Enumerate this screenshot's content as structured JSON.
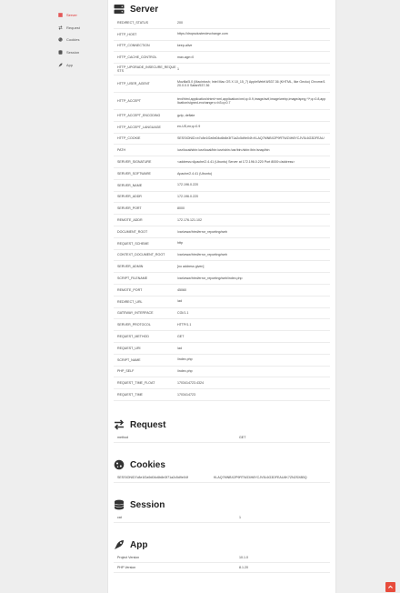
{
  "nav": {
    "items": [
      {
        "label": "Server",
        "icon": "server-icon",
        "active": true
      },
      {
        "label": "Request",
        "icon": "exchange-icon",
        "active": false
      },
      {
        "label": "Cookies",
        "icon": "cookie-icon",
        "active": false
      },
      {
        "label": "Session",
        "icon": "database-icon",
        "active": false
      },
      {
        "label": "App",
        "icon": "rocket-icon",
        "active": false
      }
    ]
  },
  "server": {
    "title": "Server",
    "rows": [
      {
        "k": "REDIRECT_STATUS",
        "v": "200"
      },
      {
        "k": "HTTP_HOST",
        "v": "https://dropsclusterdevchange.com"
      },
      {
        "k": "HTTP_CONNECTION",
        "v": "keep-alive"
      },
      {
        "k": "HTTP_CACHE_CONTROL",
        "v": "max-age=0"
      },
      {
        "k": "HTTP_UPGRADE_INSECURE_REQUESTS",
        "v": "1"
      },
      {
        "k": "HTTP_USER_AGENT",
        "v": "Mozilla/5.0 (Macintosh; Intel Mac OS X 10_15_7) AppleWebKit/537.36 (KHTML, like Gecko) Chrome/120.0.0.0 Safari/537.36"
      },
      {
        "k": "HTTP_ACCEPT",
        "v": "text/html,application/xhtml+xml,application/xml;q=0.9,image/avif,image/webp,image/apng,*/*;q=0.8,application/signed-exchange;v=b3;q=0.7"
      },
      {
        "k": "HTTP_ACCEPT_ENCODING",
        "v": "gzip, deflate"
      },
      {
        "k": "HTTP_ACCEPT_LANGUAGE",
        "v": "en-US,en;q=0.9"
      },
      {
        "k": "HTTP_COOKIE",
        "v": "SESSIONID=b7c8e1f2a9d04c6b8e3f71a2c5d9e04f=KLAQ7MNBX2P9RTWZ4H8YCJV5L6G3DFEAU"
      },
      {
        "k": "PATH",
        "v": "/usr/local/sbin:/usr/local/bin:/usr/sbin:/usr/bin:/sbin:/bin:/snap/bin"
      },
      {
        "k": "SERVER_SIGNATURE",
        "v": "<address>Apache/2.4.41 (Ubuntu) Server at 172.196.0.220 Port 8000</address>"
      },
      {
        "k": "SERVER_SOFTWARE",
        "v": "Apache/2.4.41 (Ubuntu)"
      },
      {
        "k": "SERVER_NAME",
        "v": "172.196.0.220"
      },
      {
        "k": "SERVER_ADDR",
        "v": "172.196.0.220"
      },
      {
        "k": "SERVER_PORT",
        "v": "8000"
      },
      {
        "k": "REMOTE_ADDR",
        "v": "172.176.121.102"
      },
      {
        "k": "DOCUMENT_ROOT",
        "v": "/var/www/html/error_reporting/web"
      },
      {
        "k": "REQUEST_SCHEME",
        "v": "http"
      },
      {
        "k": "CONTEXT_DOCUMENT_ROOT",
        "v": "/var/www/html/error_reporting/web"
      },
      {
        "k": "SERVER_ADMIN",
        "v": "[no address given]"
      },
      {
        "k": "SCRIPT_FILENAME",
        "v": "/var/www/html/error_reporting/web/index.php"
      },
      {
        "k": "REMOTE_PORT",
        "v": "45060"
      },
      {
        "k": "REDIRECT_URL",
        "v": "/ad"
      },
      {
        "k": "GATEWAY_INTERFACE",
        "v": "CGI/1.1"
      },
      {
        "k": "SERVER_PROTOCOL",
        "v": "HTTP/1.1"
      },
      {
        "k": "REQUEST_METHOD",
        "v": "GET"
      },
      {
        "k": "REQUEST_URI",
        "v": "/ad"
      },
      {
        "k": "SCRIPT_NAME",
        "v": "/index.php"
      },
      {
        "k": "PHP_SELF",
        "v": "/index.php"
      },
      {
        "k": "REQUEST_TIME_FLOAT",
        "v": "1703414723.4324"
      },
      {
        "k": "REQUEST_TIME",
        "v": "1703414723"
      }
    ]
  },
  "request": {
    "title": "Request",
    "rows": [
      {
        "k": "method",
        "v": "GET"
      }
    ]
  },
  "cookies": {
    "title": "Cookies",
    "rows": [
      {
        "k": "SESSIONID7c8e1f2a9d04c6b8e3f71a2c5d9e04f",
        "v": "KLAQ7MNBX2P9RTWZ4H8YCJV5L6G3DFEAU4K7ZN2SX8BQ"
      }
    ]
  },
  "session": {
    "title": "Session",
    "rows": [
      {
        "k": "cat",
        "v": "1"
      }
    ]
  },
  "app": {
    "title": "App",
    "rows": [
      {
        "k": "Project Version",
        "v": "10.1.0"
      },
      {
        "k": "PHP Version",
        "v": "8.1.20"
      }
    ]
  },
  "colors": {
    "accent": "#e02a2a",
    "scroll_button": "#e74c3c"
  }
}
